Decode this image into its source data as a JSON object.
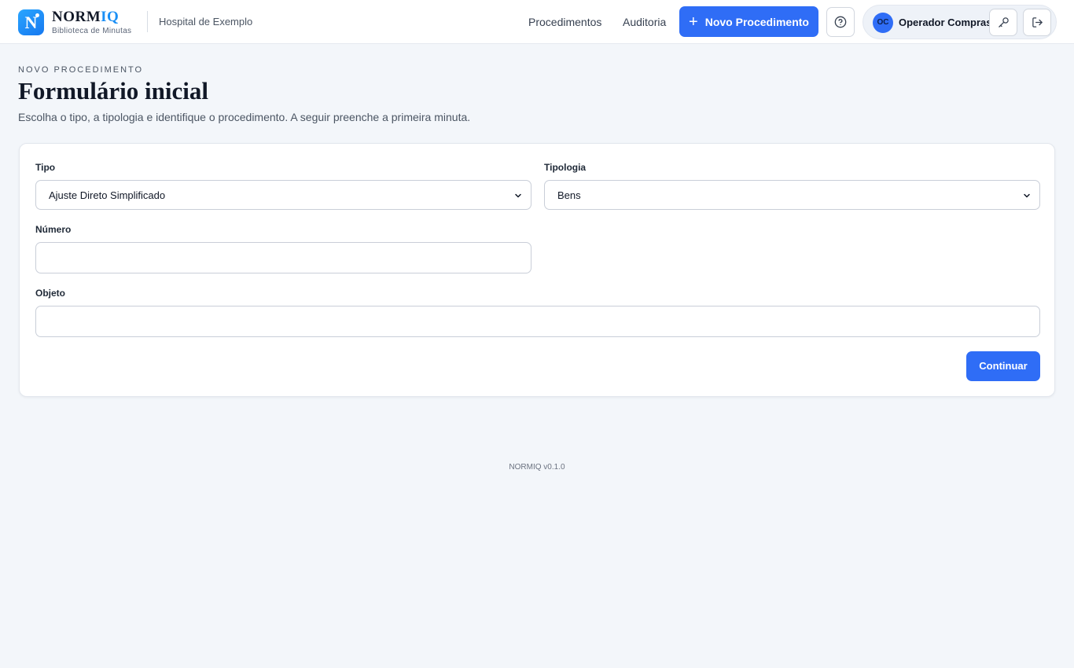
{
  "brand": {
    "logo_letter": "N",
    "name_part1": "NORM",
    "name_part2": "IQ",
    "subtitle": "Biblioteca de Minutas"
  },
  "header": {
    "organization": "Hospital de Exemplo",
    "nav": [
      {
        "label": "Procedimentos"
      },
      {
        "label": "Auditoria"
      }
    ],
    "new_button_label": "Novo Procedimento",
    "help_icon": "question-circle-icon",
    "user": {
      "initials": "OC",
      "name": "Operador Compras"
    },
    "key_icon": "key-icon",
    "logout_icon": "logout-icon"
  },
  "page": {
    "eyebrow": "NOVO PROCEDIMENTO",
    "title": "Formulário inicial",
    "subtitle": "Escolha o tipo, a tipologia e identifique o procedimento. A seguir preenche a primeira minuta."
  },
  "form": {
    "tipo": {
      "label": "Tipo",
      "value": "Ajuste Direto Simplificado"
    },
    "tipologia": {
      "label": "Tipologia",
      "value": "Bens"
    },
    "numero": {
      "label": "Número",
      "value": ""
    },
    "objeto": {
      "label": "Objeto",
      "value": ""
    },
    "continue_label": "Continuar"
  },
  "footer": {
    "version": "NORMIQ v0.1.0"
  },
  "colors": {
    "accent": "#2f6df6",
    "brand_iq": "#1a8ff5",
    "background": "#f3f6fa"
  }
}
